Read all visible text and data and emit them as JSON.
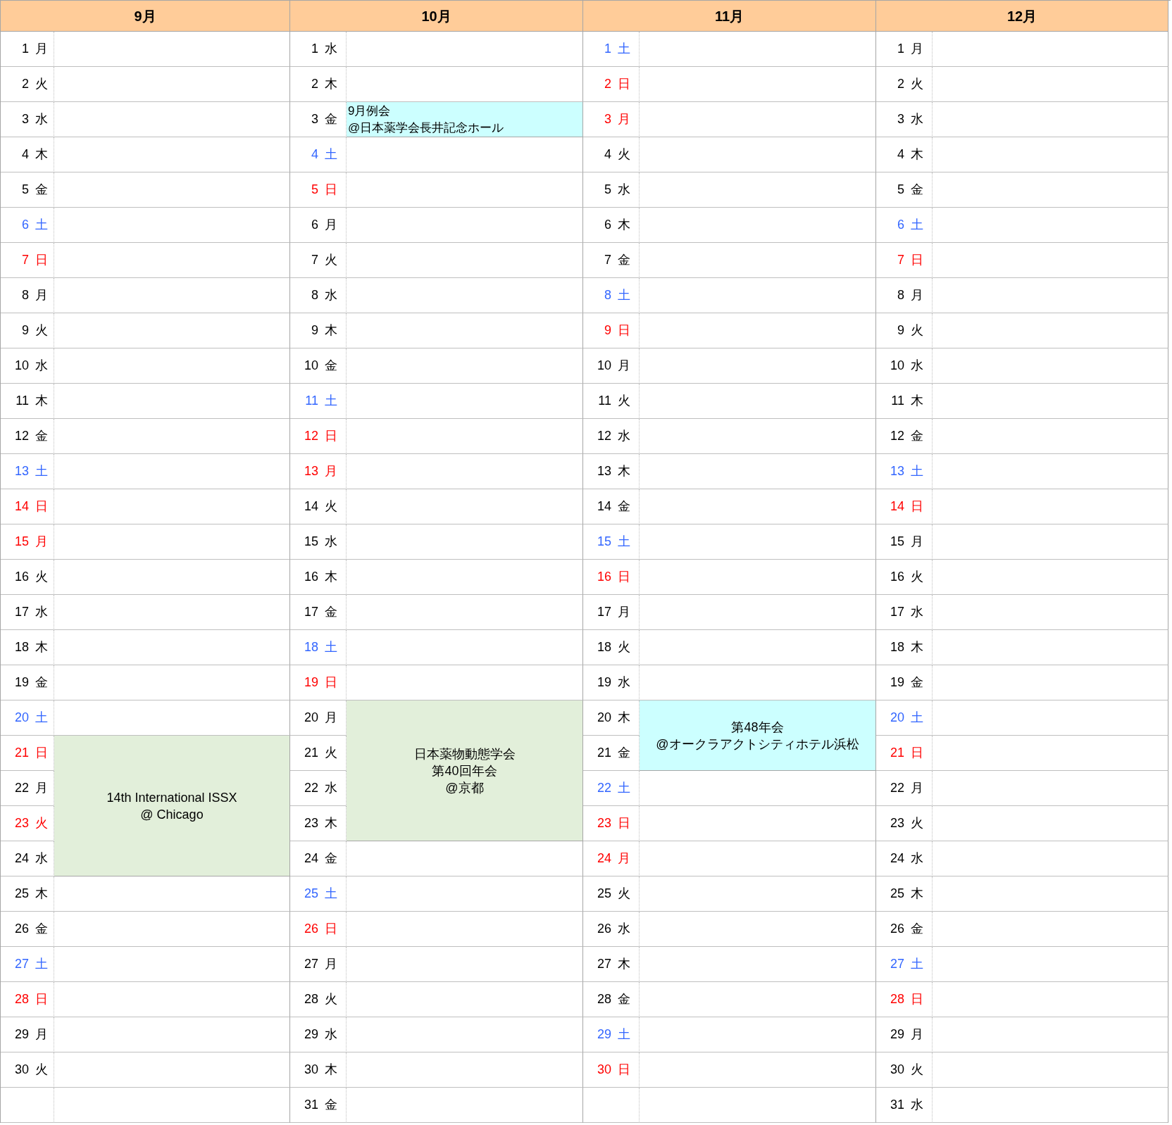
{
  "months": [
    {
      "name": "9月",
      "rows": [
        {
          "day": "1",
          "weekday": "月",
          "kind": "weekday"
        },
        {
          "day": "2",
          "weekday": "火",
          "kind": "weekday"
        },
        {
          "day": "3",
          "weekday": "水",
          "kind": "weekday"
        },
        {
          "day": "4",
          "weekday": "木",
          "kind": "weekday"
        },
        {
          "day": "5",
          "weekday": "金",
          "kind": "weekday"
        },
        {
          "day": "6",
          "weekday": "土",
          "kind": "saturday"
        },
        {
          "day": "7",
          "weekday": "日",
          "kind": "holiday"
        },
        {
          "day": "8",
          "weekday": "月",
          "kind": "weekday"
        },
        {
          "day": "9",
          "weekday": "火",
          "kind": "weekday"
        },
        {
          "day": "10",
          "weekday": "水",
          "kind": "weekday"
        },
        {
          "day": "11",
          "weekday": "木",
          "kind": "weekday"
        },
        {
          "day": "12",
          "weekday": "金",
          "kind": "weekday"
        },
        {
          "day": "13",
          "weekday": "土",
          "kind": "saturday"
        },
        {
          "day": "14",
          "weekday": "日",
          "kind": "holiday"
        },
        {
          "day": "15",
          "weekday": "月",
          "kind": "holiday"
        },
        {
          "day": "16",
          "weekday": "火",
          "kind": "weekday"
        },
        {
          "day": "17",
          "weekday": "水",
          "kind": "weekday"
        },
        {
          "day": "18",
          "weekday": "木",
          "kind": "weekday"
        },
        {
          "day": "19",
          "weekday": "金",
          "kind": "weekday"
        },
        {
          "day": "20",
          "weekday": "土",
          "kind": "saturday"
        },
        {
          "event": {
            "lines": [
              "14th International ISSX",
              "@ Chicago"
            ],
            "color": "#e2efda"
          },
          "days": [
            {
              "day": "21",
              "weekday": "日",
              "kind": "holiday"
            },
            {
              "day": "22",
              "weekday": "月",
              "kind": "weekday"
            },
            {
              "day": "23",
              "weekday": "火",
              "kind": "holiday"
            },
            {
              "day": "24",
              "weekday": "水",
              "kind": "weekday"
            }
          ]
        },
        {
          "day": "25",
          "weekday": "木",
          "kind": "weekday"
        },
        {
          "day": "26",
          "weekday": "金",
          "kind": "weekday"
        },
        {
          "day": "27",
          "weekday": "土",
          "kind": "saturday"
        },
        {
          "day": "28",
          "weekday": "日",
          "kind": "holiday"
        },
        {
          "day": "29",
          "weekday": "月",
          "kind": "weekday"
        },
        {
          "day": "30",
          "weekday": "火",
          "kind": "weekday"
        }
      ]
    },
    {
      "name": "10月",
      "rows": [
        {
          "day": "1",
          "weekday": "水",
          "kind": "weekday"
        },
        {
          "day": "2",
          "weekday": "木",
          "kind": "weekday"
        },
        {
          "event": {
            "lines": [
              "9月例会",
              "@日本薬学会長井記念ホール"
            ],
            "color": "#ccffff"
          },
          "days": [
            {
              "day": "3",
              "weekday": "金",
              "kind": "weekday"
            }
          ]
        },
        {
          "day": "4",
          "weekday": "土",
          "kind": "saturday"
        },
        {
          "day": "5",
          "weekday": "日",
          "kind": "holiday"
        },
        {
          "day": "6",
          "weekday": "月",
          "kind": "weekday"
        },
        {
          "day": "7",
          "weekday": "火",
          "kind": "weekday"
        },
        {
          "day": "8",
          "weekday": "水",
          "kind": "weekday"
        },
        {
          "day": "9",
          "weekday": "木",
          "kind": "weekday"
        },
        {
          "day": "10",
          "weekday": "金",
          "kind": "weekday"
        },
        {
          "day": "11",
          "weekday": "土",
          "kind": "saturday"
        },
        {
          "day": "12",
          "weekday": "日",
          "kind": "holiday"
        },
        {
          "day": "13",
          "weekday": "月",
          "kind": "holiday"
        },
        {
          "day": "14",
          "weekday": "火",
          "kind": "weekday"
        },
        {
          "day": "15",
          "weekday": "水",
          "kind": "weekday"
        },
        {
          "day": "16",
          "weekday": "木",
          "kind": "weekday"
        },
        {
          "day": "17",
          "weekday": "金",
          "kind": "weekday"
        },
        {
          "day": "18",
          "weekday": "土",
          "kind": "saturday"
        },
        {
          "day": "19",
          "weekday": "日",
          "kind": "holiday"
        },
        {
          "event": {
            "lines": [
              "日本薬物動態学会",
              "第40回年会",
              "@京都"
            ],
            "color": "#e2efda"
          },
          "days": [
            {
              "day": "20",
              "weekday": "月",
              "kind": "weekday"
            },
            {
              "day": "21",
              "weekday": "火",
              "kind": "weekday"
            },
            {
              "day": "22",
              "weekday": "水",
              "kind": "weekday"
            },
            {
              "day": "23",
              "weekday": "木",
              "kind": "weekday"
            }
          ]
        },
        {
          "day": "24",
          "weekday": "金",
          "kind": "weekday"
        },
        {
          "day": "25",
          "weekday": "土",
          "kind": "saturday"
        },
        {
          "day": "26",
          "weekday": "日",
          "kind": "holiday"
        },
        {
          "day": "27",
          "weekday": "月",
          "kind": "weekday"
        },
        {
          "day": "28",
          "weekday": "火",
          "kind": "weekday"
        },
        {
          "day": "29",
          "weekday": "水",
          "kind": "weekday"
        },
        {
          "day": "30",
          "weekday": "木",
          "kind": "weekday"
        },
        {
          "day": "31",
          "weekday": "金",
          "kind": "weekday"
        }
      ]
    },
    {
      "name": "11月",
      "rows": [
        {
          "day": "1",
          "weekday": "土",
          "kind": "saturday"
        },
        {
          "day": "2",
          "weekday": "日",
          "kind": "holiday"
        },
        {
          "day": "3",
          "weekday": "月",
          "kind": "holiday"
        },
        {
          "day": "4",
          "weekday": "火",
          "kind": "weekday"
        },
        {
          "day": "5",
          "weekday": "水",
          "kind": "weekday"
        },
        {
          "day": "6",
          "weekday": "木",
          "kind": "weekday"
        },
        {
          "day": "7",
          "weekday": "金",
          "kind": "weekday"
        },
        {
          "day": "8",
          "weekday": "土",
          "kind": "saturday"
        },
        {
          "day": "9",
          "weekday": "日",
          "kind": "holiday"
        },
        {
          "day": "10",
          "weekday": "月",
          "kind": "weekday"
        },
        {
          "day": "11",
          "weekday": "火",
          "kind": "weekday"
        },
        {
          "day": "12",
          "weekday": "水",
          "kind": "weekday"
        },
        {
          "day": "13",
          "weekday": "木",
          "kind": "weekday"
        },
        {
          "day": "14",
          "weekday": "金",
          "kind": "weekday"
        },
        {
          "day": "15",
          "weekday": "土",
          "kind": "saturday"
        },
        {
          "day": "16",
          "weekday": "日",
          "kind": "holiday"
        },
        {
          "day": "17",
          "weekday": "月",
          "kind": "weekday"
        },
        {
          "day": "18",
          "weekday": "火",
          "kind": "weekday"
        },
        {
          "day": "19",
          "weekday": "水",
          "kind": "weekday"
        },
        {
          "event": {
            "lines": [
              "第48年会",
              "@オークラアクトシティホテル浜松"
            ],
            "color": "#ccffff"
          },
          "days": [
            {
              "day": "20",
              "weekday": "木",
              "kind": "weekday"
            },
            {
              "day": "21",
              "weekday": "金",
              "kind": "weekday"
            }
          ]
        },
        {
          "day": "22",
          "weekday": "土",
          "kind": "saturday"
        },
        {
          "day": "23",
          "weekday": "日",
          "kind": "holiday"
        },
        {
          "day": "24",
          "weekday": "月",
          "kind": "holiday"
        },
        {
          "day": "25",
          "weekday": "火",
          "kind": "weekday"
        },
        {
          "day": "26",
          "weekday": "水",
          "kind": "weekday"
        },
        {
          "day": "27",
          "weekday": "木",
          "kind": "weekday"
        },
        {
          "day": "28",
          "weekday": "金",
          "kind": "weekday"
        },
        {
          "day": "29",
          "weekday": "土",
          "kind": "saturday"
        },
        {
          "day": "30",
          "weekday": "日",
          "kind": "holiday"
        }
      ]
    },
    {
      "name": "12月",
      "rows": [
        {
          "day": "1",
          "weekday": "月",
          "kind": "weekday"
        },
        {
          "day": "2",
          "weekday": "火",
          "kind": "weekday"
        },
        {
          "day": "3",
          "weekday": "水",
          "kind": "weekday"
        },
        {
          "day": "4",
          "weekday": "木",
          "kind": "weekday"
        },
        {
          "day": "5",
          "weekday": "金",
          "kind": "weekday"
        },
        {
          "day": "6",
          "weekday": "土",
          "kind": "saturday"
        },
        {
          "day": "7",
          "weekday": "日",
          "kind": "holiday"
        },
        {
          "day": "8",
          "weekday": "月",
          "kind": "weekday"
        },
        {
          "day": "9",
          "weekday": "火",
          "kind": "weekday"
        },
        {
          "day": "10",
          "weekday": "水",
          "kind": "weekday"
        },
        {
          "day": "11",
          "weekday": "木",
          "kind": "weekday"
        },
        {
          "day": "12",
          "weekday": "金",
          "kind": "weekday"
        },
        {
          "day": "13",
          "weekday": "土",
          "kind": "saturday"
        },
        {
          "day": "14",
          "weekday": "日",
          "kind": "holiday"
        },
        {
          "day": "15",
          "weekday": "月",
          "kind": "weekday"
        },
        {
          "day": "16",
          "weekday": "火",
          "kind": "weekday"
        },
        {
          "day": "17",
          "weekday": "水",
          "kind": "weekday"
        },
        {
          "day": "18",
          "weekday": "木",
          "kind": "weekday"
        },
        {
          "day": "19",
          "weekday": "金",
          "kind": "weekday"
        },
        {
          "day": "20",
          "weekday": "土",
          "kind": "saturday"
        },
        {
          "day": "21",
          "weekday": "日",
          "kind": "holiday"
        },
        {
          "day": "22",
          "weekday": "月",
          "kind": "weekday"
        },
        {
          "day": "23",
          "weekday": "火",
          "kind": "weekday"
        },
        {
          "day": "24",
          "weekday": "水",
          "kind": "weekday"
        },
        {
          "day": "25",
          "weekday": "木",
          "kind": "weekday"
        },
        {
          "day": "26",
          "weekday": "金",
          "kind": "weekday"
        },
        {
          "day": "27",
          "weekday": "土",
          "kind": "saturday"
        },
        {
          "day": "28",
          "weekday": "日",
          "kind": "holiday"
        },
        {
          "day": "29",
          "weekday": "月",
          "kind": "weekday"
        },
        {
          "day": "30",
          "weekday": "火",
          "kind": "weekday"
        },
        {
          "day": "31",
          "weekday": "水",
          "kind": "weekday"
        }
      ]
    }
  ]
}
